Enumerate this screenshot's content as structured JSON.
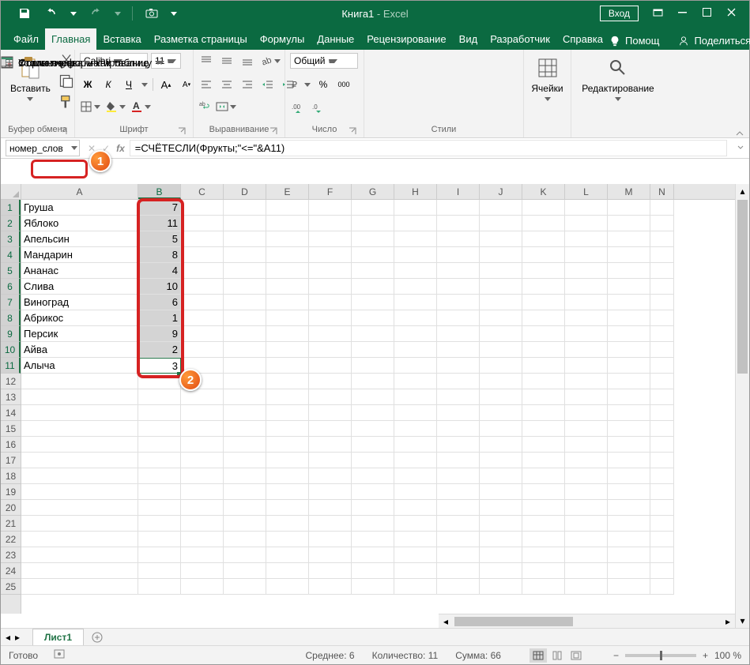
{
  "title": {
    "doc": "Книга1",
    "sep": "  -  ",
    "app": "Excel"
  },
  "login_label": "Вход",
  "tabs": [
    "Файл",
    "Главная",
    "Вставка",
    "Разметка страницы",
    "Формулы",
    "Данные",
    "Рецензирование",
    "Вид",
    "Разработчик",
    "Справка"
  ],
  "active_tab": 1,
  "help_label": "Помощ",
  "share_label": "Поделиться",
  "ribbon": {
    "clipboard": {
      "paste": "Вставить",
      "group": "Буфер обмена"
    },
    "font": {
      "name": "Calibri",
      "size": "11",
      "group": "Шрифт"
    },
    "alignment": {
      "group": "Выравнивание"
    },
    "number": {
      "format": "Общий",
      "group": "Число"
    },
    "styles": {
      "cond": "Условное форматирование",
      "table": "Форматировать как таблицу",
      "cell": "Стили ячеек",
      "group": "Стили"
    },
    "cells": {
      "label": "Ячейки"
    },
    "editing": {
      "label": "Редактирование"
    }
  },
  "namebox": "номер_слов",
  "formula": "=СЧЁТЕСЛИ(Фрукты;\"<=\"&A11)",
  "columns": [
    "A",
    "B",
    "C",
    "D",
    "E",
    "F",
    "G",
    "H",
    "I",
    "J",
    "K",
    "L",
    "M",
    "N"
  ],
  "rows": [
    {
      "n": 1,
      "a": "Груша",
      "b": "7"
    },
    {
      "n": 2,
      "a": "Яблоко",
      "b": "11"
    },
    {
      "n": 3,
      "a": "Апельсин",
      "b": "5"
    },
    {
      "n": 4,
      "a": "Мандарин",
      "b": "8"
    },
    {
      "n": 5,
      "a": "Ананас",
      "b": "4"
    },
    {
      "n": 6,
      "a": "Слива",
      "b": "10"
    },
    {
      "n": 7,
      "a": "Виноград",
      "b": "6"
    },
    {
      "n": 8,
      "a": "Абрикос",
      "b": "1"
    },
    {
      "n": 9,
      "a": "Персик",
      "b": "9"
    },
    {
      "n": 10,
      "a": "Айва",
      "b": "2"
    },
    {
      "n": 11,
      "a": "Алыча",
      "b": "3"
    }
  ],
  "total_rows": 25,
  "sheet": "Лист1",
  "status": {
    "ready": "Готово",
    "avg_label": "Среднее:",
    "avg": "6",
    "count_label": "Количество:",
    "count": "11",
    "sum_label": "Сумма:",
    "sum": "66",
    "zoom": "100 %"
  },
  "callouts": {
    "one": "1",
    "two": "2"
  }
}
